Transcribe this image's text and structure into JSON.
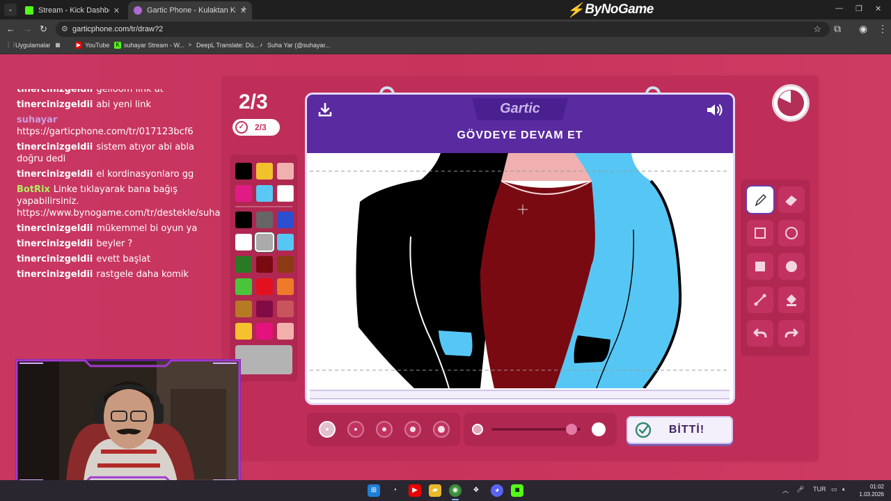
{
  "browser": {
    "tabs": [
      {
        "label": "Stream - Kick Dashboard",
        "favicon_color": "#53fc18",
        "active": false
      },
      {
        "label": "Gartic Phone - Kulaktan Kulağa",
        "favicon_color": "#b06ad6",
        "active": true
      }
    ],
    "url": "garticphone.com/tr/draw?2",
    "bookmarks": [
      {
        "label": "Uygulamalar",
        "icon": "apps-grid-icon"
      },
      {
        "label": "YouTube",
        "icon": "youtube-icon"
      },
      {
        "label": "suhayar Stream - W...",
        "icon": "kick-icon"
      },
      {
        "label": "DeepL Translate: Dü...",
        "icon": "deepl-icon"
      },
      {
        "label": "Suha Yar (@suhayar...",
        "icon": "tiktok-icon"
      }
    ]
  },
  "watermark": "ByNoGame",
  "chat": {
    "messages": [
      {
        "user": "tinercinizgeldii",
        "text": "gelloom link at",
        "kind": "normal"
      },
      {
        "user": "tinercinizgeldii",
        "text": "abi yeni link",
        "kind": "normal"
      },
      {
        "user": "suhayar",
        "text": "https://garticphone.com/tr/017123bcf6",
        "kind": "mod"
      },
      {
        "user": "tinercinizgeldii",
        "text": "sistem atıyor abi abla doğru dedi",
        "kind": "normal"
      },
      {
        "user": "tinercinizgeldii",
        "text": "el kordinasyonlaro gg",
        "kind": "normal"
      },
      {
        "user": "BotRix",
        "text": "Linke tıklayarak bana bağış yapabilirsiniz. https://www.bynogame.com/tr/destekle/suhayar",
        "kind": "bot"
      },
      {
        "user": "tinercinizgeldii",
        "text": "mükemmel bi oyun ya",
        "kind": "normal"
      },
      {
        "user": "tinercinizgeldii",
        "text": "beyler ?",
        "kind": "normal"
      },
      {
        "user": "tinercinizgeldii",
        "text": "evett başlat",
        "kind": "normal"
      },
      {
        "user": "tinercinizgeldii",
        "text": "rastgele daha komik",
        "kind": "normal"
      }
    ]
  },
  "game": {
    "round": "2/3",
    "done_count": "2/3",
    "logo": "Gartic",
    "prompt": "GÖVDEYE DEVAM ET",
    "done_button": "BİTTİ!",
    "timer_remaining_fraction": 0.82,
    "palette": {
      "top": [
        "#000000",
        "#f2c12e",
        "#f0b0b0",
        "#e01c84",
        "#5ac8f5",
        "#ffffff"
      ],
      "grid": [
        "#000000",
        "#666666",
        "#2b4fcf",
        "#ffffff",
        "#aaaaaa",
        "#56c7f5",
        "#2a7a25",
        "#7a0a12",
        "#8b3a14",
        "#4bc43c",
        "#e3111e",
        "#ef7a2a",
        "#b57a23",
        "#800b45",
        "#c8545e",
        "#f5c22d",
        "#e3127c",
        "#f2b0ac"
      ],
      "selected_index": 4,
      "current_color": "#b3b3b3"
    },
    "brush_sizes_selected_index": 0,
    "opacity_level": 0.9,
    "tools": [
      {
        "name": "pencil-icon",
        "selected": true
      },
      {
        "name": "eraser-icon",
        "selected": false
      },
      {
        "name": "rectangle-outline-icon",
        "selected": false
      },
      {
        "name": "ellipse-outline-icon",
        "selected": false
      },
      {
        "name": "rectangle-filled-icon",
        "selected": false
      },
      {
        "name": "ellipse-filled-icon",
        "selected": false
      },
      {
        "name": "line-icon",
        "selected": false
      },
      {
        "name": "fill-bucket-icon",
        "selected": false
      },
      {
        "name": "undo-icon",
        "selected": false
      },
      {
        "name": "redo-icon",
        "selected": false
      }
    ]
  },
  "taskbar": {
    "lang": "TUR",
    "time": "01:02",
    "date": "1.03.2026"
  }
}
